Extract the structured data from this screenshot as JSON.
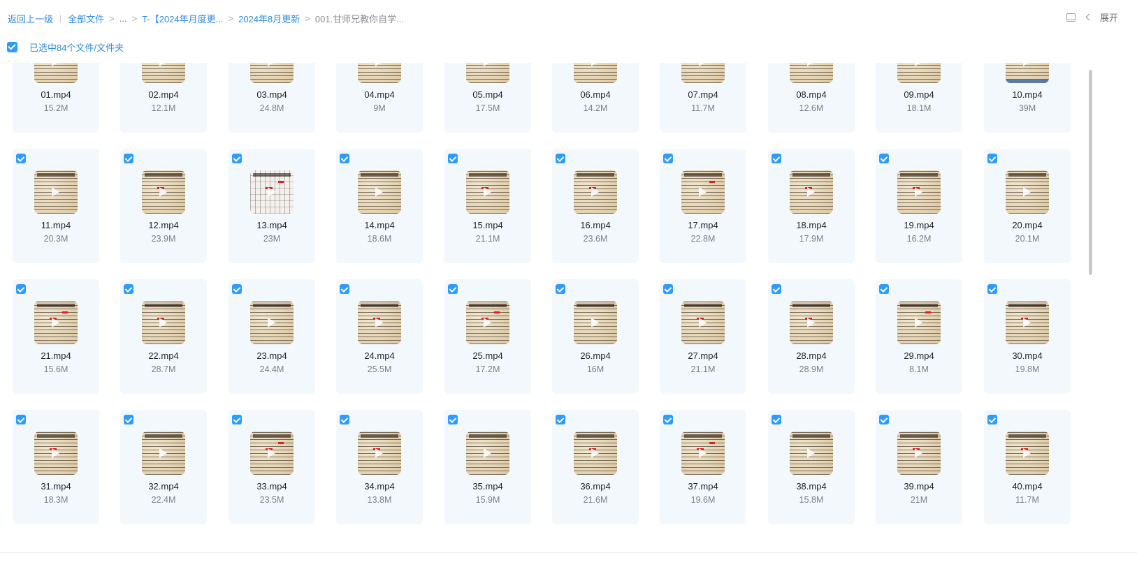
{
  "breadcrumb": {
    "back": "返回上一级",
    "all_files": "全部文件",
    "ellipsis": "...",
    "folder1": "T-【2024年月度更...",
    "folder2": "2024年8月更新",
    "current": "001.甘师兄教你自学..."
  },
  "toolbar": {
    "expand_label": "展开",
    "view_icon": "layout-icon",
    "chevron_icon": "chevron-left-icon"
  },
  "selection": {
    "text": "已选中84个文件/文件夹"
  },
  "colors": {
    "accent": "#2e9cff",
    "tile_bg": "#f3f8fd"
  },
  "files": [
    {
      "name": "01.mp4",
      "size": "15.2M"
    },
    {
      "name": "02.mp4",
      "size": "12.1M"
    },
    {
      "name": "03.mp4",
      "size": "24.8M"
    },
    {
      "name": "04.mp4",
      "size": "9M"
    },
    {
      "name": "05.mp4",
      "size": "17.5M"
    },
    {
      "name": "06.mp4",
      "size": "14.2M"
    },
    {
      "name": "07.mp4",
      "size": "11.7M"
    },
    {
      "name": "08.mp4",
      "size": "12.6M"
    },
    {
      "name": "09.mp4",
      "size": "18.1M"
    },
    {
      "name": "10.mp4",
      "size": "39M"
    },
    {
      "name": "11.mp4",
      "size": "20.3M"
    },
    {
      "name": "12.mp4",
      "size": "23.9M"
    },
    {
      "name": "13.mp4",
      "size": "23M"
    },
    {
      "name": "14.mp4",
      "size": "18.6M"
    },
    {
      "name": "15.mp4",
      "size": "21.1M"
    },
    {
      "name": "16.mp4",
      "size": "23.6M"
    },
    {
      "name": "17.mp4",
      "size": "22.8M"
    },
    {
      "name": "18.mp4",
      "size": "17.9M"
    },
    {
      "name": "19.mp4",
      "size": "16.2M"
    },
    {
      "name": "20.mp4",
      "size": "20.1M"
    },
    {
      "name": "21.mp4",
      "size": "15.6M"
    },
    {
      "name": "22.mp4",
      "size": "28.7M"
    },
    {
      "name": "23.mp4",
      "size": "24.4M"
    },
    {
      "name": "24.mp4",
      "size": "25.5M"
    },
    {
      "name": "25.mp4",
      "size": "17.2M"
    },
    {
      "name": "26.mp4",
      "size": "16M"
    },
    {
      "name": "27.mp4",
      "size": "21.1M"
    },
    {
      "name": "28.mp4",
      "size": "28.9M"
    },
    {
      "name": "29.mp4",
      "size": "8.1M"
    },
    {
      "name": "30.mp4",
      "size": "19.8M"
    },
    {
      "name": "31.mp4",
      "size": "18.3M"
    },
    {
      "name": "32.mp4",
      "size": "22.4M"
    },
    {
      "name": "33.mp4",
      "size": "23.5M"
    },
    {
      "name": "34.mp4",
      "size": "13.8M"
    },
    {
      "name": "35.mp4",
      "size": "15.9M"
    },
    {
      "name": "36.mp4",
      "size": "21.6M"
    },
    {
      "name": "37.mp4",
      "size": "19.6M"
    },
    {
      "name": "38.mp4",
      "size": "15.8M"
    },
    {
      "name": "39.mp4",
      "size": "21M"
    },
    {
      "name": "40.mp4",
      "size": "11.7M"
    }
  ]
}
